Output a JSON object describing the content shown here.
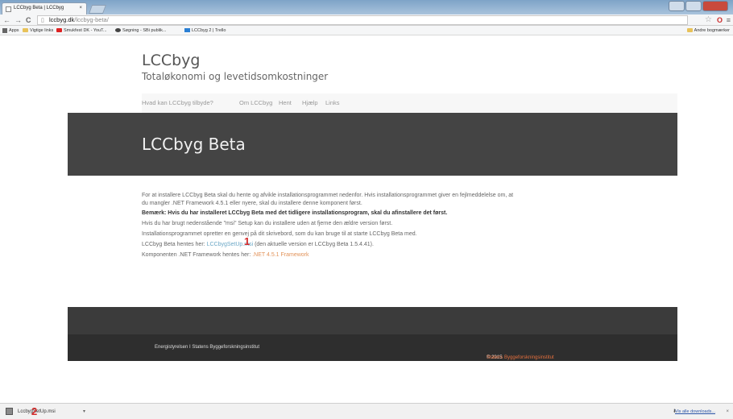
{
  "browser": {
    "tab_title": "LCCbyg Beta | LCCbyg",
    "tab_close": "×",
    "url_host": "lccbyg.dk",
    "url_path": "/lccbyg-beta/",
    "nav_back": "←",
    "nav_forward": "→",
    "nav_reload": "C",
    "bookmarks": [
      {
        "label": "Apps",
        "icon": "apps-icon"
      },
      {
        "label": "Vigtige links",
        "icon": "folder-icon"
      },
      {
        "label": "Smukfest DK - YouT...",
        "icon": "youtube-icon"
      },
      {
        "label": "Søgning - SBi publik...",
        "icon": "nk-icon"
      },
      {
        "label": "LCCbyg 2 | Trello",
        "icon": "trello-icon"
      }
    ],
    "other_bookmarks": "Andre bogmærker"
  },
  "site": {
    "title": "LCCbyg",
    "subtitle": "Totaløkonomi og levetidsomkostninger",
    "nav": [
      {
        "label": "Hvad kan LCCbyg tilbyde?"
      },
      {
        "label": "Om LCCbyg"
      },
      {
        "label": "Hent"
      },
      {
        "label": "Hjælp"
      },
      {
        "label": "Links"
      }
    ],
    "hero_title": "LCCbyg Beta"
  },
  "content": {
    "p1_line1": "For at installere LCCbyg Beta skal du hente og afvikle installationsprogrammet nedenfor. Hvis installationsprogrammet giver en fejlmeddelelse om, at",
    "p1_line2": "du mangler .NET Framework 4.5.1 eller nyere, skal du installere denne komponent først.",
    "p2": "Bemærk: Hvis du har installeret LCCbyg Beta med det tidligere installationsprogram, skal du afinstallere det først.",
    "p3": "Hvis du har brugt nedenstående \"msi\" Setup kan du installere uden at fjerne den ældre version først.",
    "p4": "Installationsprogrammet opretter en genvej på dit skrivebord, som du kan bruge til at starte LCCbyg Beta med.",
    "p5_prefix": "LCCbyg Beta hentes her: ",
    "p5_link": "LCCbygSetUp.msi",
    "p5_suffix": " (den aktuelle version er LCCbyg Beta 1.5.4.41).",
    "p6_prefix": "Komponenten .NET Framework hentes her: ",
    "p6_link": ".NET 4.5.1 Framework",
    "marker1": "1",
    "marker2": "2"
  },
  "footer": {
    "left": "Energistyrelsen  I  Statens Byggeforskningsinstitut",
    "copyright": "© 2015 ",
    "copyright_link": "Statens Byggeforskningsinstitut"
  },
  "downloads": {
    "file": "LccbygSetUp.msi",
    "show_all": "Vis alle downloads...",
    "close": "×"
  },
  "colors": {
    "hero_bg": "#444444",
    "footer_bg": "#2e2e2e",
    "link_blue": "#6aa7c6",
    "link_orange": "#e2935a",
    "marker_red": "#d42a2a"
  }
}
